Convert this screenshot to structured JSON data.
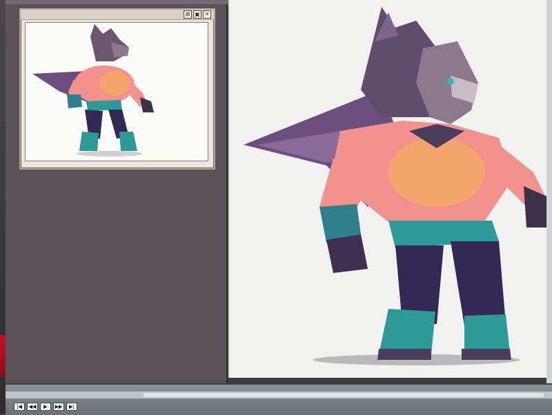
{
  "preview_window": {
    "title_buttons": [
      "⊞",
      "▣",
      "✕"
    ]
  },
  "bottom_bar": {
    "nav_buttons": [
      "|◀",
      "◀◀",
      "▶",
      "▶▶",
      "▶|"
    ]
  },
  "colors": {
    "accent_red": "#c1122a",
    "fur_purple": "#6d4f7e",
    "skin_pink": "#f1928f",
    "skin_orange": "#f3a56b",
    "boots_teal": "#2c9a97",
    "pants_navy": "#322a55"
  }
}
